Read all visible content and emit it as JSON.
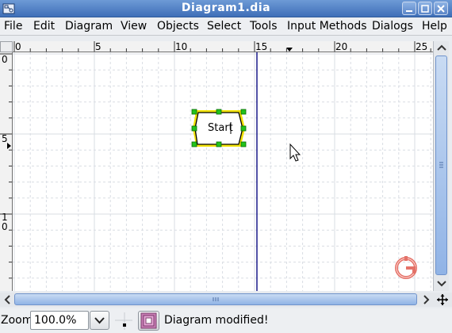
{
  "window": {
    "title": "Diagram1.dia"
  },
  "menubar": {
    "items": [
      {
        "label": "File",
        "key": "F"
      },
      {
        "label": "Edit",
        "key": "E"
      },
      {
        "label": "Diagram",
        "key": "D"
      },
      {
        "label": "View",
        "key": "V"
      },
      {
        "label": "Objects",
        "key": "O"
      },
      {
        "label": "Select",
        "key": "S"
      },
      {
        "label": "Tools",
        "key": "T"
      },
      {
        "label": "Input Methods",
        "key": "I"
      },
      {
        "label": "Dialogs",
        "key": "i"
      },
      {
        "label": "Help",
        "key": "H"
      }
    ]
  },
  "hruler": {
    "labels": [
      "0",
      "5",
      "10",
      "15",
      "20",
      "25"
    ]
  },
  "vruler": {
    "labels": [
      "0",
      "5",
      "1",
      "0"
    ]
  },
  "canvas": {
    "shape": {
      "text": "Start",
      "type": "hexagon",
      "selected": true
    },
    "colors": {
      "grid": "#d9dde3",
      "guide": "#1a1a8a",
      "selection": "#f2e200",
      "handle": "#22c21c"
    }
  },
  "statusbar": {
    "zoom_label": "Zoom",
    "zoom_value": "100.0%",
    "message": "Diagram modified!"
  },
  "icons": {
    "app": "dia-app-icon",
    "minimize": "minimize-icon",
    "maximize": "maximize-icon",
    "close": "close-icon",
    "watermark": "dia-logo-icon",
    "cursor": "mouse-pointer-icon"
  }
}
